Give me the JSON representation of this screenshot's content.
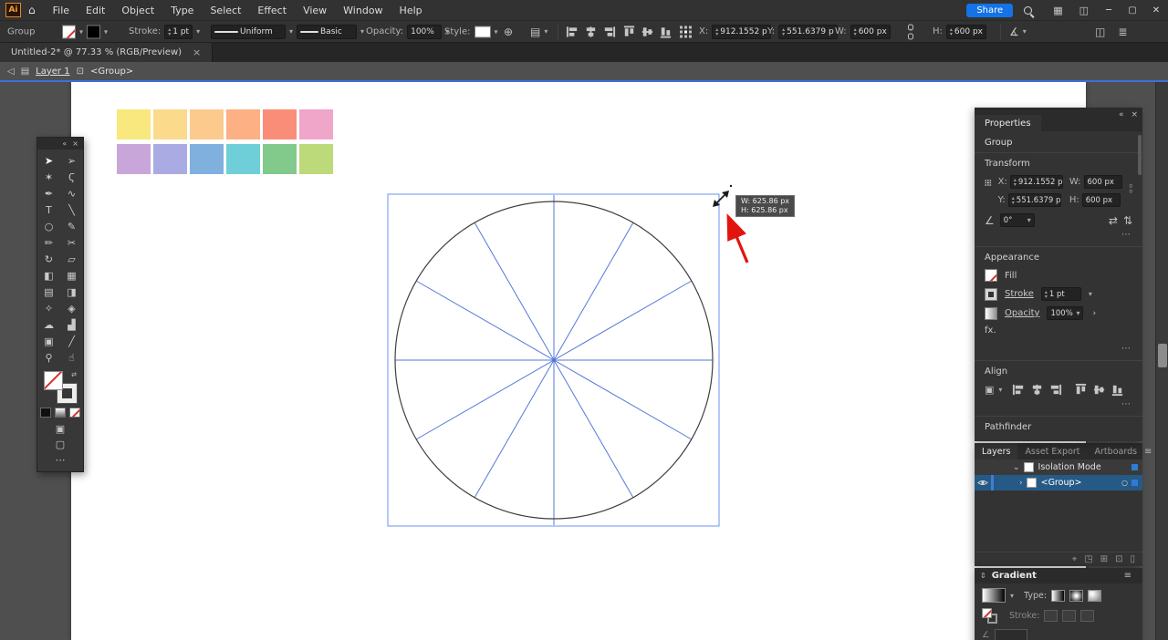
{
  "titlebar": {
    "logo_text": "Ai",
    "menus": [
      "File",
      "Edit",
      "Object",
      "Type",
      "Select",
      "Effect",
      "View",
      "Window",
      "Help"
    ],
    "share_label": "Share"
  },
  "controlbar": {
    "context_label": "Group",
    "stroke_label": "Stroke:",
    "stroke_value": "1 pt",
    "profile_value": "Uniform",
    "brush_value": "Basic",
    "opacity_label": "Opacity:",
    "opacity_value": "100%",
    "style_label": "Style:",
    "x_label": "X:",
    "x_value": "912.1552 p",
    "y_label": "Y:",
    "y_value": "551.6379 p",
    "w_label": "W:",
    "w_value": "600 px",
    "h_label": "H:",
    "h_value": "600 px"
  },
  "tabbar": {
    "doc_title": "Untitled-2* @ 77.33 % (RGB/Preview)"
  },
  "breadcrumb": {
    "layer_label": "Layer 1",
    "group_label": "<Group>"
  },
  "tools": [
    {
      "name": "selection-tool",
      "glyph": "➤"
    },
    {
      "name": "direct-selection-tool",
      "glyph": "➢"
    },
    {
      "name": "magic-wand-tool",
      "glyph": "✶"
    },
    {
      "name": "lasso-tool",
      "glyph": "Ϛ"
    },
    {
      "name": "pen-tool",
      "glyph": "✒"
    },
    {
      "name": "curvature-tool",
      "glyph": "∿"
    },
    {
      "name": "type-tool",
      "glyph": "T"
    },
    {
      "name": "line-segment-tool",
      "glyph": "╲"
    },
    {
      "name": "ellipse-tool",
      "glyph": "○"
    },
    {
      "name": "paintbrush-tool",
      "glyph": "✎"
    },
    {
      "name": "pencil-tool",
      "glyph": "✏"
    },
    {
      "name": "scissors-tool",
      "glyph": "✂"
    },
    {
      "name": "rotate-tool",
      "glyph": "↻"
    },
    {
      "name": "scale-tool",
      "glyph": "▱"
    },
    {
      "name": "shape-builder-tool",
      "glyph": "◧"
    },
    {
      "name": "perspective-grid-tool",
      "glyph": "▦"
    },
    {
      "name": "mesh-tool",
      "glyph": "▤"
    },
    {
      "name": "gradient-tool",
      "glyph": "◨"
    },
    {
      "name": "eyedropper-tool",
      "glyph": "✧"
    },
    {
      "name": "blend-tool",
      "glyph": "◈"
    },
    {
      "name": "symbol-sprayer-tool",
      "glyph": "☁"
    },
    {
      "name": "column-graph-tool",
      "glyph": "▟"
    },
    {
      "name": "artboard-tool",
      "glyph": "▣"
    },
    {
      "name": "slice-tool",
      "glyph": "╱"
    },
    {
      "name": "zoom-tool",
      "glyph": "⚲"
    },
    {
      "name": "hand-tool",
      "glyph": "☝"
    }
  ],
  "canvas": {
    "swatches": {
      "row1": [
        "#f8e87d",
        "#fbda8c",
        "#fcca8d",
        "#fcb083",
        "#f98d78",
        "#f0a6c9"
      ],
      "row2": [
        "#c9a6da",
        "#a9abe2",
        "#7fb0de",
        "#6fcfd8",
        "#82c98c",
        "#bcda79"
      ]
    },
    "tooltip": {
      "line1": "W: 625.86 px",
      "line2": "H: 625.86 px"
    }
  },
  "properties": {
    "panel_title": "Properties",
    "context_label": "Group",
    "transform": {
      "section_label": "Transform",
      "x_label": "X:",
      "x_value": "912.1552 p",
      "y_label": "Y:",
      "y_value": "551.6379 p",
      "w_label": "W:",
      "w_value": "600 px",
      "h_label": "H:",
      "h_value": "600 px",
      "angle_value": "0°"
    },
    "appearance": {
      "section_label": "Appearance",
      "fill_label": "Fill",
      "stroke_label": "Stroke",
      "stroke_value": "1 pt",
      "opacity_label": "Opacity",
      "opacity_value": "100%",
      "fx_label": "fx."
    },
    "align": {
      "section_label": "Align"
    },
    "pathfinder": {
      "section_label": "Pathfinder"
    }
  },
  "layers": {
    "tabs": [
      "Layers",
      "Asset Export",
      "Artboards"
    ],
    "rows": [
      {
        "label": "Isolation Mode"
      },
      {
        "label": "<Group>"
      }
    ]
  },
  "gradient": {
    "panel_title": "Gradient",
    "type_label": "Type:",
    "stroke_label": "Stroke:"
  },
  "icons": {
    "home": "⌂",
    "minimize": "─",
    "maximize": "▢",
    "close_win": "✕",
    "close": "×",
    "collapse_h": "«",
    "collapse_v": "⇕",
    "chevron_down": "▾",
    "tree_open": "⌄",
    "tree_closed": "›",
    "more_dots": "⋯",
    "hamburger": "≡",
    "back": "◁",
    "layer_glyph": "▤",
    "group_glyph": "⊡",
    "globe": "⊕",
    "doc_setup": "▤",
    "shear": "∡",
    "dock": "◫",
    "panel_options": "≣",
    "angle": "∠",
    "flip_h": "⇄",
    "flip_v": "⇅",
    "target": "○",
    "swap": "⇄",
    "fx_dot": "⋯",
    "locate": "⌖",
    "mask": "◳",
    "sublayer": "⊞",
    "new_layer": "⊡",
    "trash": "▯"
  },
  "colors": {
    "accent_blue": "#3f6fd8",
    "selection_blue": "#5d8ef0",
    "share_blue": "#1473e6",
    "annotation_red": "#e2140e",
    "circle_stroke": "#3f3f3f"
  }
}
